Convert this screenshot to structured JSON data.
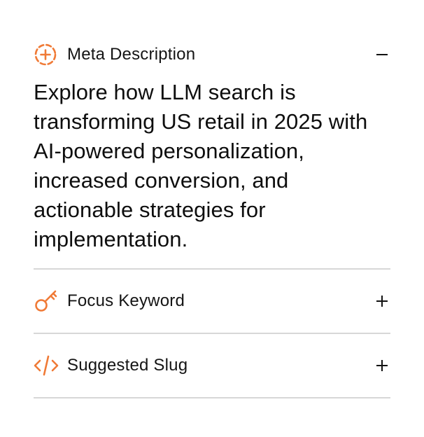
{
  "accordion": {
    "meta_description": {
      "title": "Meta Description",
      "icon": "dashed-circle-plus-icon",
      "toggle_icon": "minus-icon",
      "expanded": true,
      "content": "Explore how LLM search is transforming US retail in 2025 with AI-powered personalization, increased conversion, and actionable strategies for implementation."
    },
    "focus_keyword": {
      "title": "Focus Keyword",
      "icon": "key-icon",
      "toggle_icon": "plus-icon",
      "expanded": false
    },
    "suggested_slug": {
      "title": "Suggested Slug",
      "icon": "code-icon",
      "toggle_icon": "plus-icon",
      "expanded": false
    }
  },
  "colors": {
    "accent": "#f07a36",
    "text": "#111111",
    "divider": "#d7d7d7"
  }
}
